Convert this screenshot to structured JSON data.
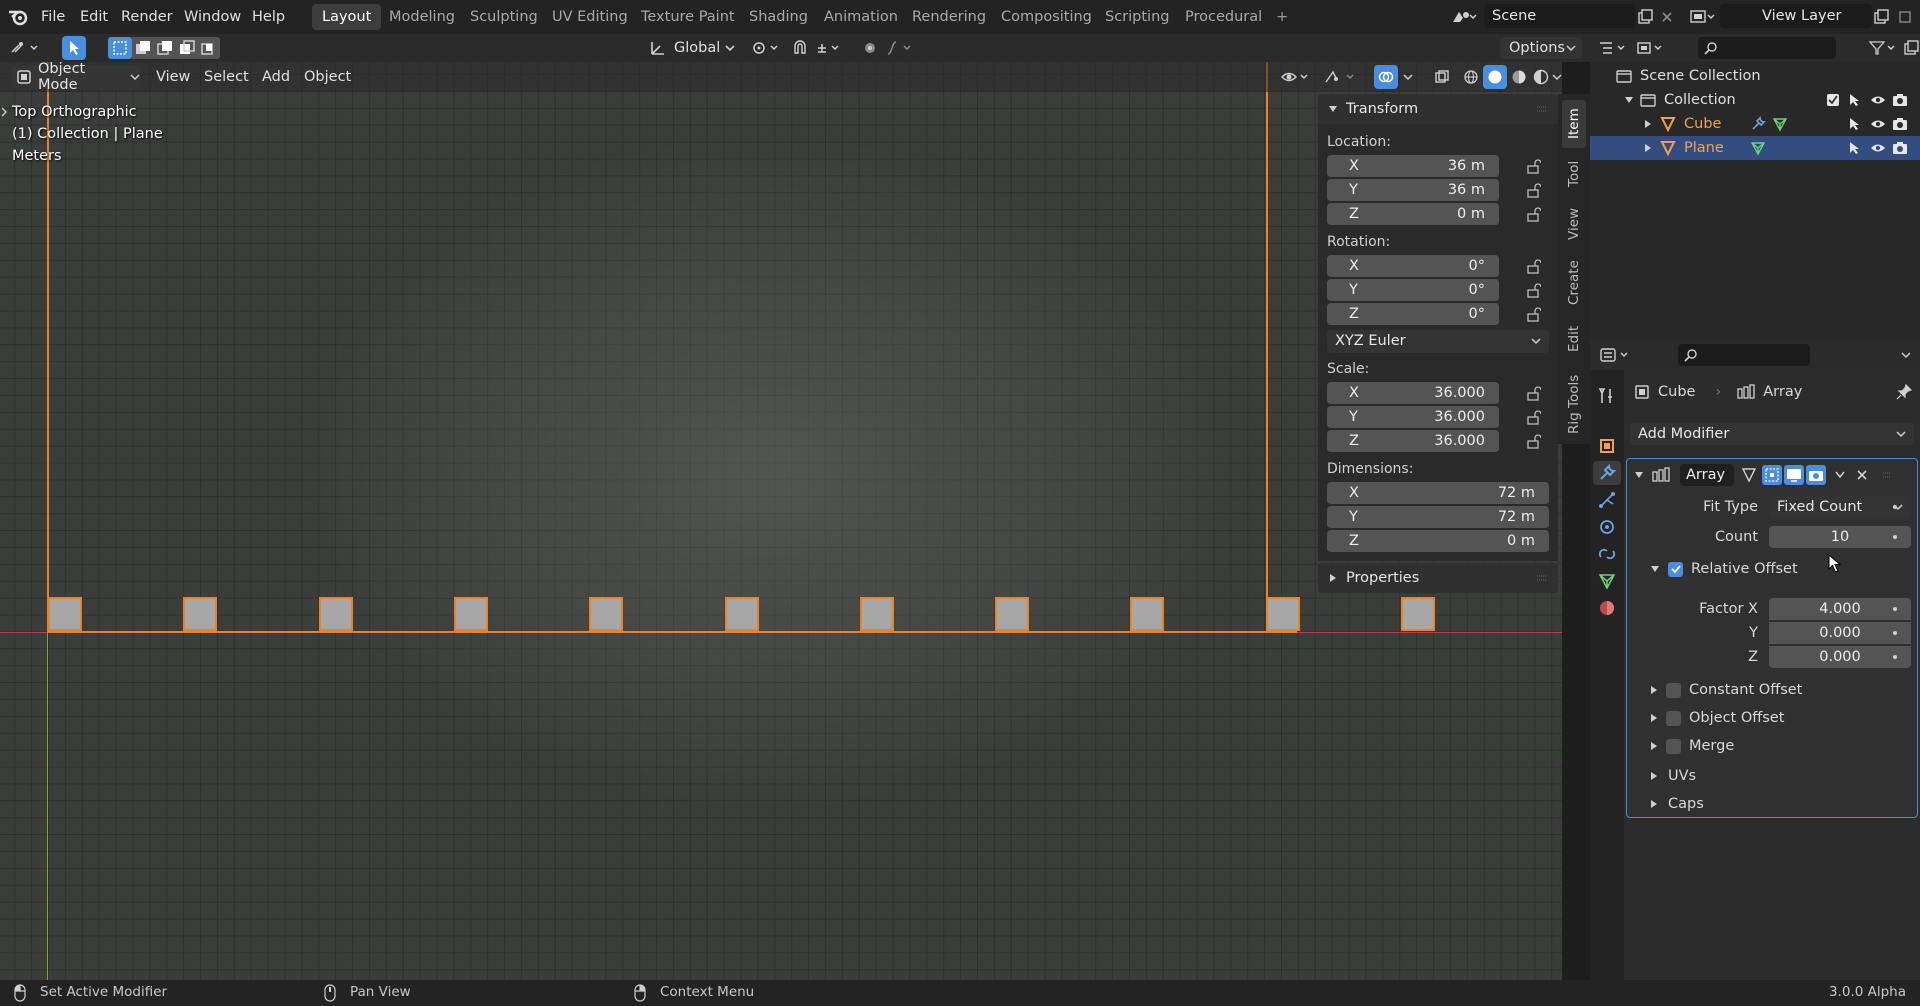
{
  "app": {
    "version": "3.0.0 Alpha"
  },
  "menus": [
    "File",
    "Edit",
    "Render",
    "Window",
    "Help"
  ],
  "workspaces": [
    "Layout",
    "Modeling",
    "Sculpting",
    "UV Editing",
    "Texture Paint",
    "Shading",
    "Animation",
    "Rendering",
    "Compositing",
    "Scripting",
    "Procedural"
  ],
  "active_workspace": "Layout",
  "topbar": {
    "scene": "Scene",
    "view_layer": "View Layer",
    "add_tab": "+"
  },
  "tool_header": {
    "orientation": "Global",
    "options": "Options"
  },
  "viewport": {
    "mode": "Object Mode",
    "menus": [
      "View",
      "Select",
      "Add",
      "Object"
    ],
    "view_name": "Top Orthographic",
    "collection_info": "(1) Collection | Plane",
    "units": "Meters",
    "array_copies": 11
  },
  "npanel": {
    "transform_title": "Transform",
    "location_label": "Location:",
    "location": {
      "x": "36 m",
      "y": "36 m",
      "z": "0 m"
    },
    "rotation_label": "Rotation:",
    "rotation": {
      "x": "0°",
      "y": "0°",
      "z": "0°"
    },
    "rotation_mode": "XYZ Euler",
    "scale_label": "Scale:",
    "scale": {
      "x": "36.000",
      "y": "36.000",
      "z": "36.000"
    },
    "dimensions_label": "Dimensions:",
    "dimensions": {
      "x": "72 m",
      "y": "72 m",
      "z": "0 m"
    },
    "axis": {
      "x": "X",
      "y": "Y",
      "z": "Z"
    },
    "properties_title": "Properties",
    "tabs": [
      "Item",
      "Tool",
      "View",
      "Create",
      "Edit",
      "Rig Tools"
    ]
  },
  "outliner": {
    "scene_collection": "Scene Collection",
    "collection": "Collection",
    "items": [
      "Cube",
      "Plane"
    ]
  },
  "properties": {
    "object_name": "Cube",
    "modifier_crumb": "Array",
    "add_modifier": "Add Modifier",
    "modifier": {
      "name": "Array",
      "fit_type_label": "Fit Type",
      "fit_type": "Fixed Count",
      "count_label": "Count",
      "count": "10",
      "relative_offset": "Relative Offset",
      "factor_x_label": "Factor X",
      "y_label": "Y",
      "z_label": "Z",
      "factor_x": "4.000",
      "factor_y": "0.000",
      "factor_z": "0.000",
      "constant_offset": "Constant Offset",
      "object_offset": "Object Offset",
      "merge": "Merge",
      "uvs": "UVs",
      "caps": "Caps"
    }
  },
  "statusbar": {
    "left": "Set Active Modifier",
    "middle": "Pan View",
    "right": "Context Menu"
  },
  "colors": {
    "accent": "#4a8ee0",
    "selection": "#e8832a",
    "object_orange": "#f0a050",
    "mesh_green": "#6cd37a"
  }
}
